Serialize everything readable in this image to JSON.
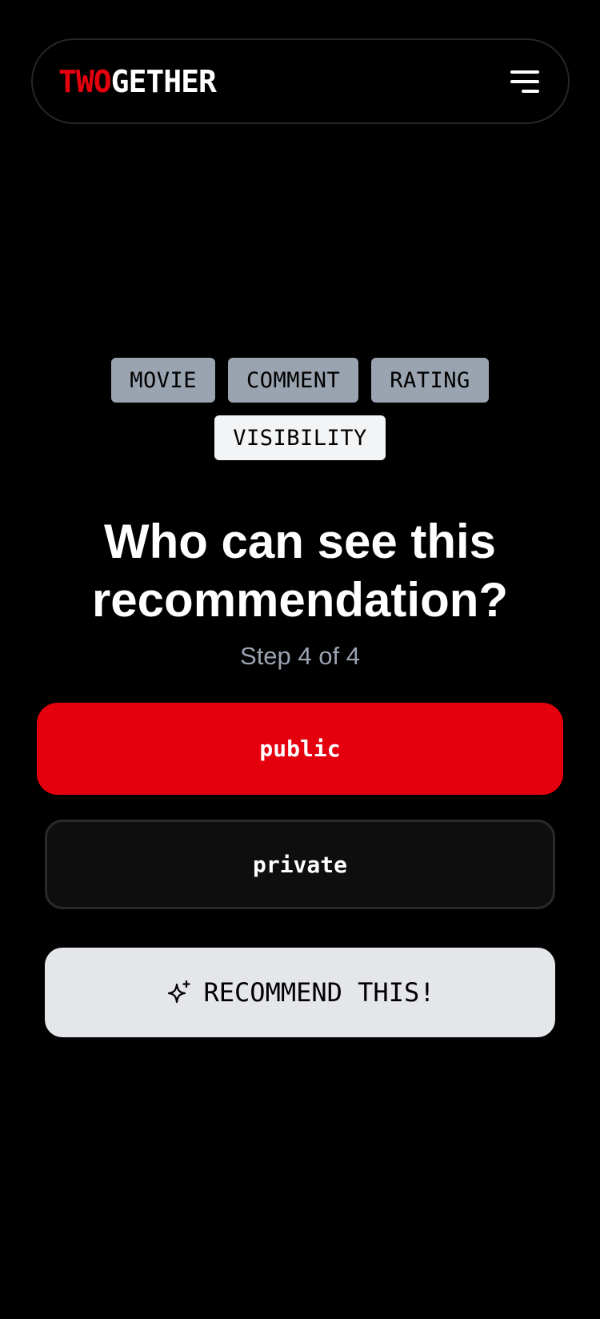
{
  "header": {
    "logo_accent": "TWO",
    "logo_rest": "GETHER",
    "menu_icon": "hamburger-menu-icon"
  },
  "steps": {
    "tabs": [
      {
        "label": "MOVIE",
        "active": false
      },
      {
        "label": "COMMENT",
        "active": false
      },
      {
        "label": "RATING",
        "active": false
      },
      {
        "label": "VISIBILITY",
        "active": true
      }
    ]
  },
  "main": {
    "title": "Who can see this recommendation?",
    "step_text": "Step 4 of 4",
    "options": [
      {
        "label": "public",
        "selected": true
      },
      {
        "label": "private",
        "selected": false
      }
    ],
    "submit_label": "RECOMMEND THIS!",
    "submit_icon": "sparkle-icon"
  },
  "colors": {
    "accent": "#e5000d",
    "background": "#000000",
    "tab_inactive": "#9aa3b0",
    "tab_active": "#f3f4f6",
    "submit_bg": "#e4e6ea"
  }
}
